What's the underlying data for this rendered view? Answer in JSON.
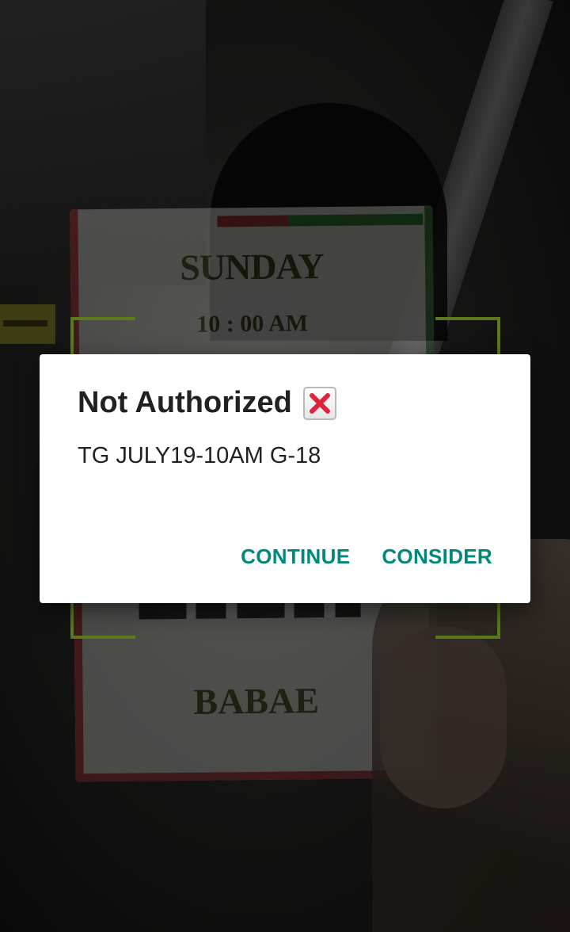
{
  "camera_view": {
    "card": {
      "day_text": "SUNDAY",
      "time_text": "10 : 00 AM",
      "bottom_text": "BABAE"
    }
  },
  "dialog": {
    "title": "Not Authorized",
    "title_icon": "cross-mark-icon",
    "message": "TG JULY19-10AM G-18",
    "buttons": {
      "continue_label": "CONTINUE",
      "consider_label": "CONSIDER"
    }
  },
  "colors": {
    "accent": "#00897b",
    "viewfinder": "#5b7a1e",
    "icon_cross": "#e0233b"
  }
}
